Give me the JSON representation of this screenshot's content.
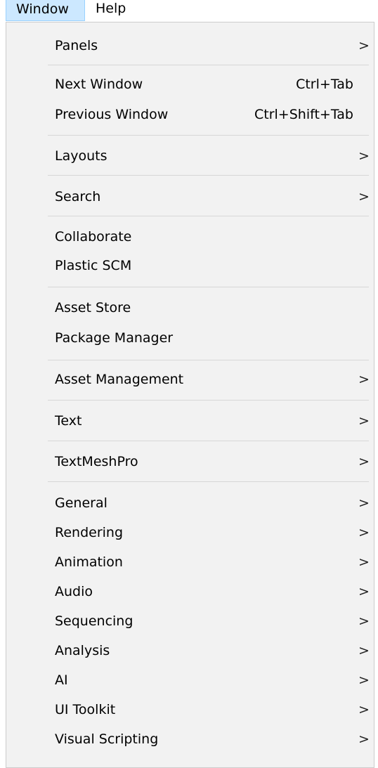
{
  "menubar": {
    "window_label": "Window",
    "help_label": "Help"
  },
  "menu": {
    "items": [
      {
        "label": "Panels",
        "submenu": true
      },
      {
        "label": "Next Window",
        "shortcut": "Ctrl+Tab"
      },
      {
        "label": "Previous Window",
        "shortcut": "Ctrl+Shift+Tab"
      },
      {
        "label": "Layouts",
        "submenu": true
      },
      {
        "label": "Search",
        "submenu": true
      },
      {
        "label": "Collaborate"
      },
      {
        "label": "Plastic SCM"
      },
      {
        "label": "Asset Store"
      },
      {
        "label": "Package Manager"
      },
      {
        "label": "Asset Management",
        "submenu": true
      },
      {
        "label": "Text",
        "submenu": true
      },
      {
        "label": "TextMeshPro",
        "submenu": true
      },
      {
        "label": "General",
        "submenu": true
      },
      {
        "label": "Rendering",
        "submenu": true
      },
      {
        "label": "Animation",
        "submenu": true
      },
      {
        "label": "Audio",
        "submenu": true
      },
      {
        "label": "Sequencing",
        "submenu": true
      },
      {
        "label": "Analysis",
        "submenu": true
      },
      {
        "label": "AI",
        "submenu": true
      },
      {
        "label": "UI Toolkit",
        "submenu": true
      },
      {
        "label": "Visual Scripting",
        "submenu": true
      }
    ],
    "submenu_glyph": ">"
  }
}
